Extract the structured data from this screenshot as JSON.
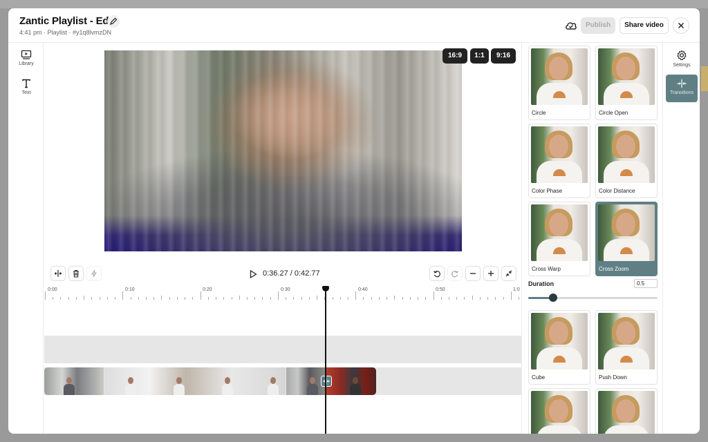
{
  "header": {
    "title": "Zantic Playlist - Edit",
    "subtitle": "4:41 pm · Playlist · #y1q8lvmzDN",
    "publish_label": "Publish",
    "share_label": "Share video"
  },
  "left_sidebar": {
    "items": [
      {
        "label": "Library",
        "icon": "library-icon"
      },
      {
        "label": "Text",
        "icon": "text-icon"
      }
    ]
  },
  "preview": {
    "aspect_ratios": [
      "16:9",
      "1:1",
      "9:16"
    ]
  },
  "playback": {
    "time": "0:36.27 / 0:42.77"
  },
  "timeline": {
    "ruler_labels": [
      "0:00",
      "0:10",
      "0:20",
      "0:30",
      "0:40",
      "0:50",
      "1:0"
    ]
  },
  "transitions": {
    "items": [
      {
        "label": "Circle",
        "selected": false
      },
      {
        "label": "Circle Open",
        "selected": false
      },
      {
        "label": "Color Phase",
        "selected": false
      },
      {
        "label": "Color Distance",
        "selected": false
      },
      {
        "label": "Cross Warp",
        "selected": false
      },
      {
        "label": "Cross Zoom",
        "selected": true
      },
      {
        "label": "Cube",
        "selected": false
      },
      {
        "label": "Push Down",
        "selected": false
      }
    ],
    "duration_label": "Duration",
    "duration_value": "0.5",
    "duration_slider_fraction": 0.19
  },
  "right_sidebar": {
    "items": [
      {
        "label": "Settings",
        "icon": "gear-icon",
        "active": false
      },
      {
        "label": "Transitions",
        "icon": "transitions-icon",
        "active": true
      }
    ]
  },
  "colors": {
    "accent": "#5f7f85",
    "publish_disabled_bg": "#e6e6e6"
  }
}
